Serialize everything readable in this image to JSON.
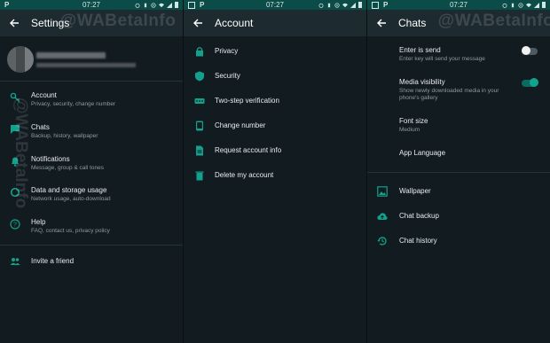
{
  "statusbar": {
    "time": "07:27"
  },
  "watermark": "@WABetaInfo",
  "colors": {
    "accent": "#10a38f",
    "statusbar": "#0b4b48",
    "background": "#121b20"
  },
  "settings": {
    "title": "Settings",
    "items": [
      {
        "icon": "key-icon",
        "label": "Account",
        "sub": "Privacy, security, change number"
      },
      {
        "icon": "chat-icon",
        "label": "Chats",
        "sub": "Backup, history, wallpaper"
      },
      {
        "icon": "bell-icon",
        "label": "Notifications",
        "sub": "Message, group & call tones"
      },
      {
        "icon": "data-usage-icon",
        "label": "Data and storage usage",
        "sub": "Network usage, auto-download"
      },
      {
        "icon": "help-icon",
        "label": "Help",
        "sub": "FAQ, contact us, privacy policy"
      }
    ],
    "invite": {
      "icon": "people-icon",
      "label": "Invite a friend"
    }
  },
  "account": {
    "title": "Account",
    "items": [
      {
        "icon": "lock-icon",
        "label": "Privacy"
      },
      {
        "icon": "shield-icon",
        "label": "Security"
      },
      {
        "icon": "dots-icon",
        "label": "Two-step verification"
      },
      {
        "icon": "phone-icon",
        "label": "Change number"
      },
      {
        "icon": "document-icon",
        "label": "Request account info"
      },
      {
        "icon": "trash-icon",
        "label": "Delete my account"
      }
    ]
  },
  "chats": {
    "title": "Chats",
    "enter_is_send": {
      "label": "Enter is send",
      "sub": "Enter key will send your message",
      "on": false
    },
    "media_visibility": {
      "label": "Media visibility",
      "sub": "Show newly downloaded media in your",
      "sub2": "phone's gallery",
      "on": true
    },
    "font_size": {
      "label": "Font size",
      "sub": "Medium"
    },
    "app_language": {
      "label": "App Language"
    },
    "wallpaper": {
      "icon": "wallpaper-icon",
      "label": "Wallpaper"
    },
    "chat_backup": {
      "icon": "cloud-upload-icon",
      "label": "Chat backup"
    },
    "chat_history": {
      "icon": "history-icon",
      "label": "Chat history"
    }
  }
}
